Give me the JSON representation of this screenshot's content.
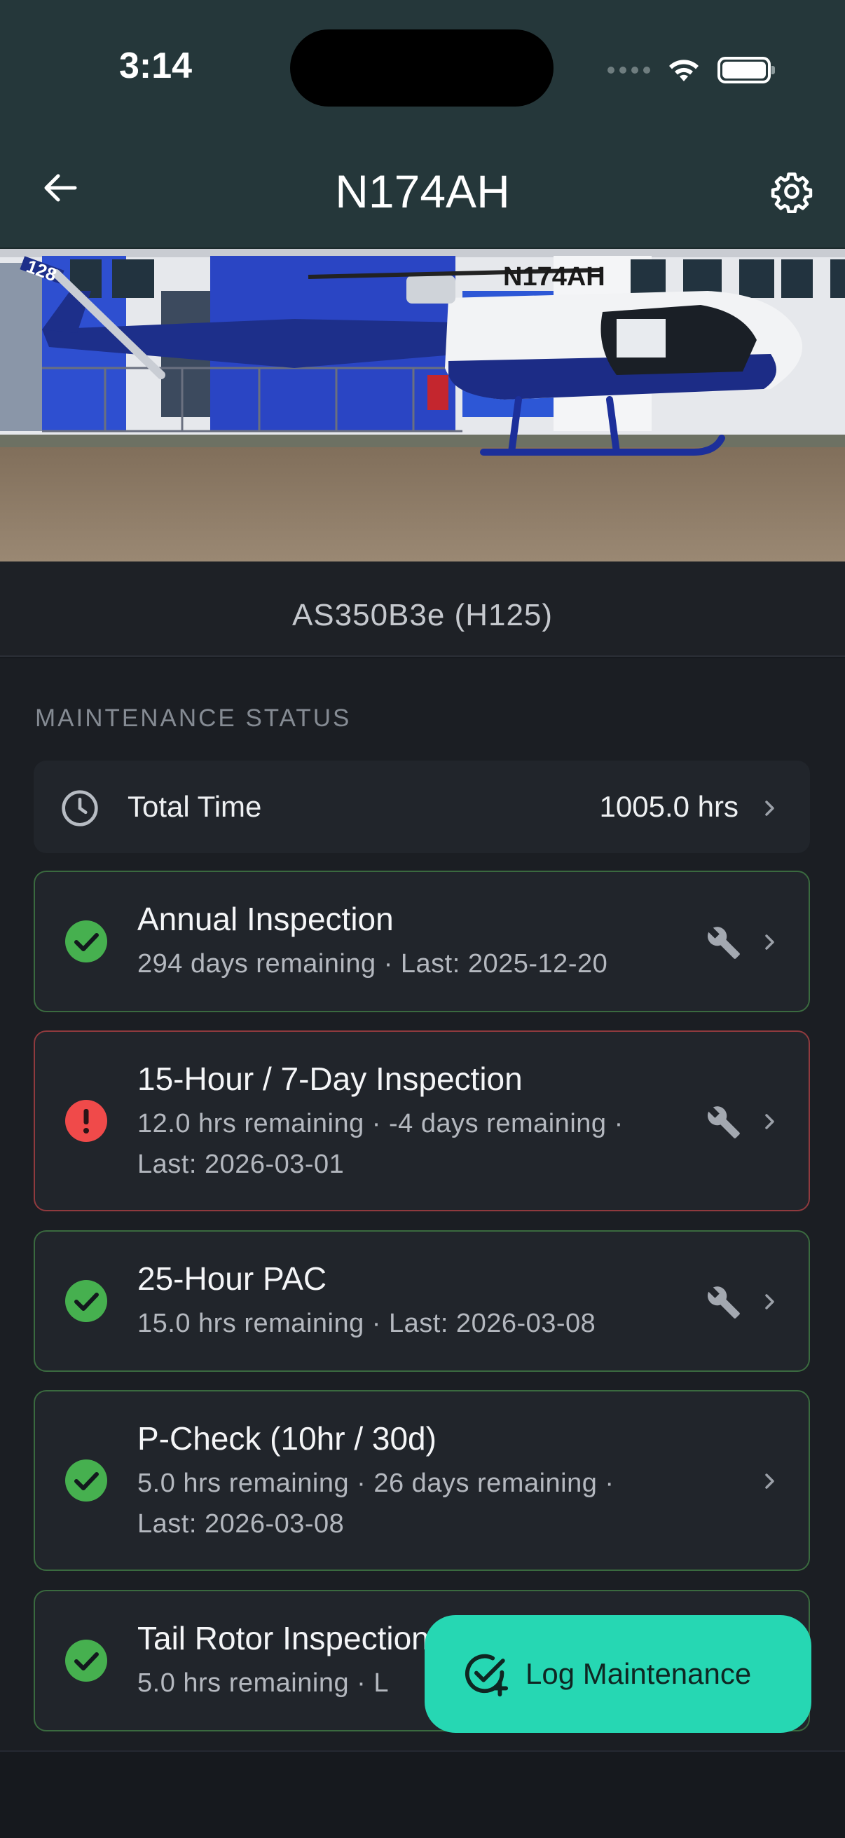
{
  "status_bar": {
    "time": "3:14"
  },
  "nav": {
    "title": "N174AH",
    "back_icon": "arrow-left-icon",
    "settings_icon": "gear-icon"
  },
  "hero": {
    "tail_number": "N174AH",
    "tail_code": "128"
  },
  "aircraft": {
    "model": "AS350B3e (H125)"
  },
  "section": {
    "title": "MAINTENANCE STATUS"
  },
  "total_time": {
    "label": "Total Time",
    "value": "1005.0 hrs",
    "icon": "clock-icon"
  },
  "items": [
    {
      "title": "Annual Inspection",
      "line1": "294 days remaining  ·  Last: 2025-12-20",
      "line2": "",
      "status": "ok"
    },
    {
      "title": "15-Hour / 7-Day Inspection",
      "line1": "12.0 hrs remaining  ·  -4 days remaining  ·",
      "line2": "Last: 2026-03-01",
      "status": "alert"
    },
    {
      "title": "25-Hour PAC",
      "line1": "15.0 hrs remaining  ·  Last: 2026-03-08",
      "line2": "",
      "status": "ok"
    },
    {
      "title": "P-Check (10hr / 30d)",
      "line1": "5.0 hrs remaining  ·  26 days remaining  ·",
      "line2": "Last: 2026-03-08",
      "status": "ok"
    },
    {
      "title": "Tail Rotor Inspection",
      "line1": "5.0 hrs remaining  ·  L",
      "line2": "",
      "status": "ok"
    }
  ],
  "fab": {
    "label": "Log Maintenance",
    "icon": "check-circle-plus-icon"
  },
  "colors": {
    "ok": "#46b04f",
    "alert": "#f04a4a",
    "accent": "#26d7b3",
    "header": "#25373a"
  }
}
